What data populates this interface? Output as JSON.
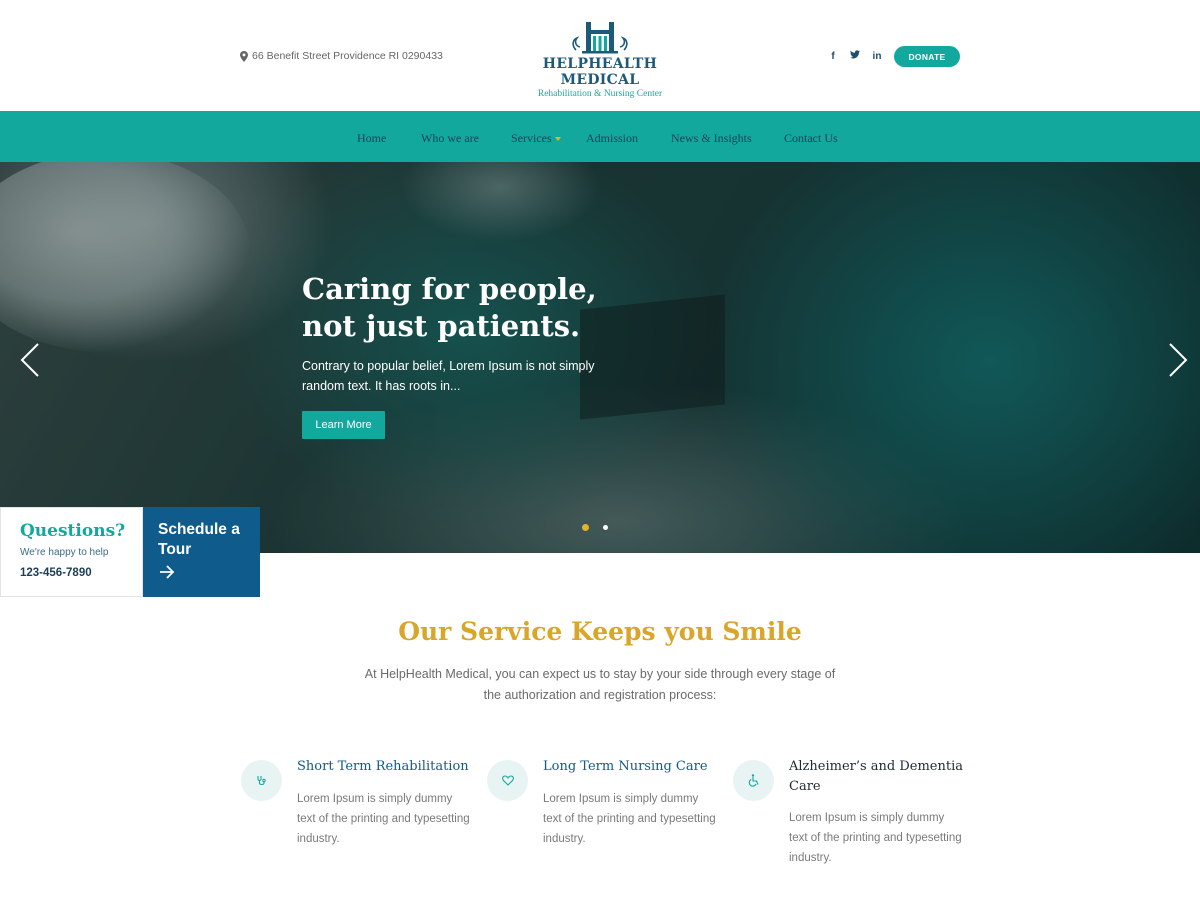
{
  "header": {
    "address": "66 Benefit Street Providence RI 0290433",
    "logo_name": "HELPHEALTH MEDICAL",
    "logo_tagline": "Rehabilitation & Nursing Center",
    "social": [
      {
        "icon": "facebook-icon",
        "glyph": "f"
      },
      {
        "icon": "twitter-icon",
        "glyph": "t"
      },
      {
        "icon": "linkedin-icon",
        "glyph": "in"
      }
    ],
    "donate_label": "DONATE"
  },
  "nav": {
    "items": [
      {
        "label": "Home"
      },
      {
        "label": "Who we are"
      },
      {
        "label": "Services",
        "has_dropdown": true
      },
      {
        "label": "Admission"
      },
      {
        "label": "News & Insights"
      },
      {
        "label": "Contact Us"
      }
    ]
  },
  "hero": {
    "title": "Caring for people, not just patients.",
    "text": "Contrary to popular belief, Lorem Ipsum is not simply random text. It has roots in...",
    "button_label": "Learn More",
    "slides": 2,
    "active_slide": 1
  },
  "contact_card": {
    "title": "Questions?",
    "subtitle": "We're happy to help",
    "phone": "123-456-7890",
    "schedule_label": "Schedule a Tour"
  },
  "services": {
    "title": "Our Service Keeps you Smile",
    "intro": "At HelpHealth Medical, you can expect us to stay by your side through every stage of the authorization and registration process:",
    "items": [
      {
        "icon": "stethoscope-icon",
        "title": "Short Term Rehabilitation",
        "text": "Lorem Ipsum is simply dummy text of the printing and typesetting industry."
      },
      {
        "icon": "heart-icon",
        "title": "Long Term Nursing Care",
        "text": "Lorem Ipsum is simply dummy text of the printing and typesetting industry."
      },
      {
        "icon": "wheelchair-icon",
        "title": "Alzheimer’s and Dementia Care",
        "text": "Lorem Ipsum is simply dummy text of the printing and typesetting industry."
      }
    ]
  },
  "colors": {
    "teal": "#13a89e",
    "navy": "#0e5b8c",
    "gold": "#d9a62a"
  }
}
